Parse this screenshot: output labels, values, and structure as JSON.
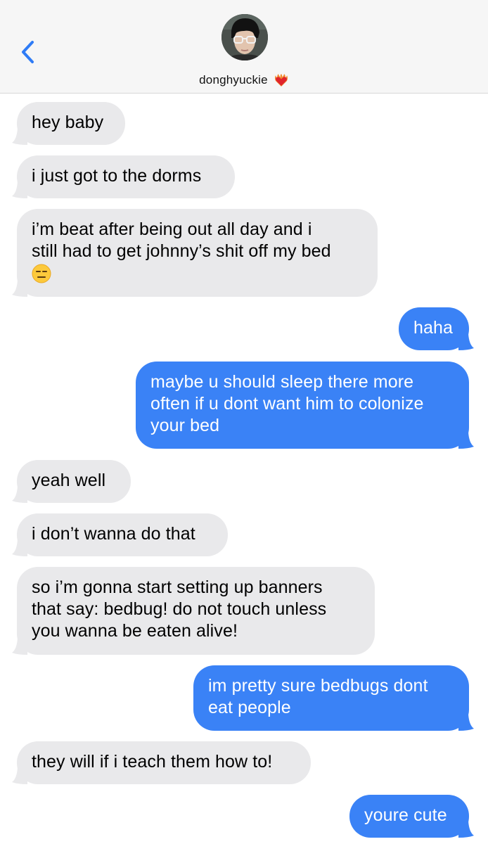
{
  "contact": {
    "name": "donghyuckie",
    "status_icon": "heart-on-fire-icon"
  },
  "colors": {
    "incoming": "#e9e9eb",
    "outgoing": "#3a82f6",
    "accent": "#2f7cf6"
  },
  "messages": [
    {
      "from": "them",
      "lines": [
        "hey baby"
      ]
    },
    {
      "from": "them",
      "lines": [
        "i just got to the dorms"
      ]
    },
    {
      "from": "them",
      "lines": [
        "i’m beat after being out all day and i",
        "still had to get johnny’s shit off my bed"
      ],
      "emoji": "expressionless-face"
    },
    {
      "from": "me",
      "lines": [
        "haha"
      ]
    },
    {
      "from": "me",
      "lines": [
        "maybe u should sleep there more",
        "often if u dont want him to colonize",
        "your bed"
      ]
    },
    {
      "from": "them",
      "lines": [
        "yeah well"
      ]
    },
    {
      "from": "them",
      "lines": [
        "i don’t wanna do that"
      ]
    },
    {
      "from": "them",
      "lines": [
        "so i’m gonna start setting up banners",
        "that say: bedbug! do not touch unless",
        "you wanna be eaten alive!"
      ]
    },
    {
      "from": "me",
      "lines": [
        "im pretty sure bedbugs dont",
        "eat people"
      ]
    },
    {
      "from": "them",
      "lines": [
        "they will if i teach them how to!"
      ]
    },
    {
      "from": "me",
      "lines": [
        "youre cute"
      ]
    }
  ]
}
